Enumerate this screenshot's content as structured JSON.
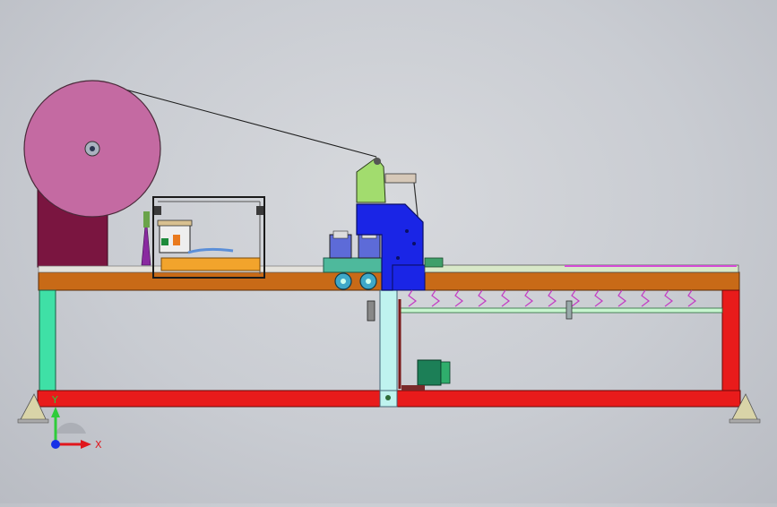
{
  "triad": {
    "x_label": "X",
    "y_label": "Y",
    "x_color": "#e0161c",
    "y_color": "#2ecc3a",
    "z_color": "#1730e6"
  },
  "colors": {
    "background": "#cfd1d6",
    "spool": "#c46aa2",
    "spool_stand": "#7a1540",
    "table_top": "#c86a17",
    "frame_base": "#e81b1b",
    "leg_left": "#3fe0a6",
    "leg_mid": "#bff3ef",
    "dancer_arm": "#a2dc6e",
    "blue_housing": "#1a25e6",
    "conveyor": "#d8e8c8",
    "conveyor_rail": "#d44bd6",
    "motor": "#1c7f57",
    "shaft": "#c8f5cf",
    "gripper_magenta": "#c33bc4",
    "tray_orange": "#f2a42c"
  },
  "icons": [
    "coordinate-triad-icon"
  ]
}
